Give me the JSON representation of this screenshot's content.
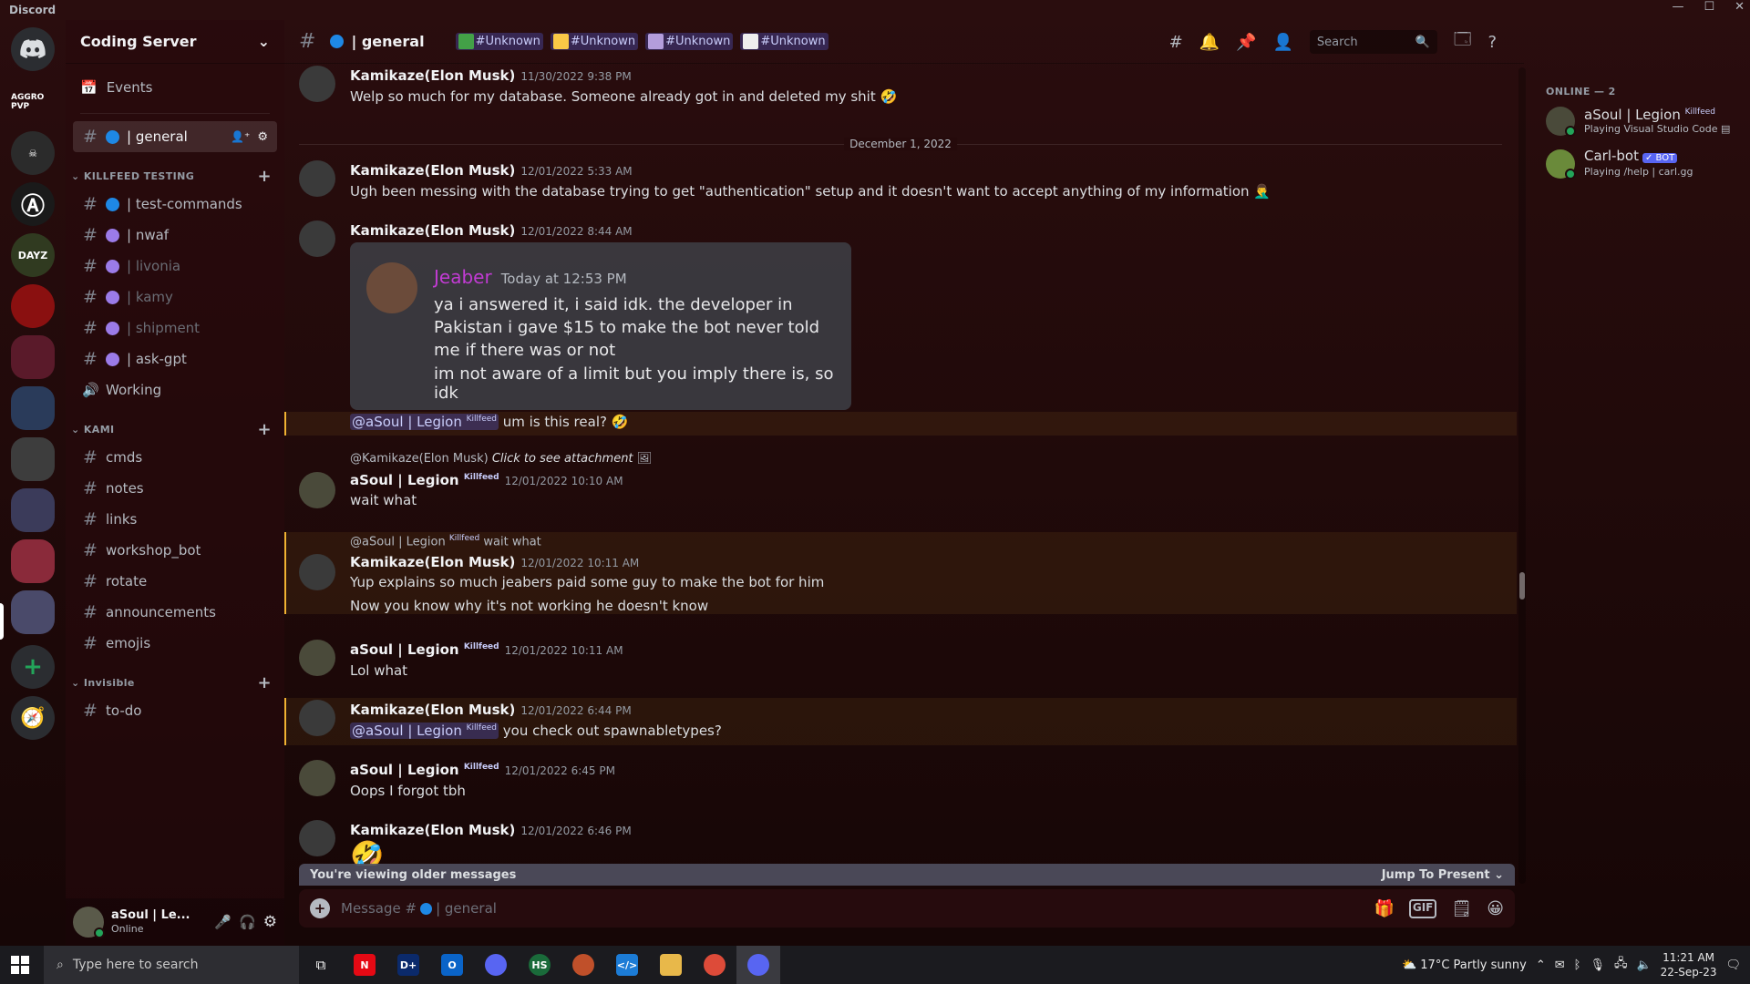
{
  "window": {
    "app_name": "Discord",
    "controls": [
      "—",
      "☐",
      "✕"
    ]
  },
  "rail": {
    "servers": [
      {
        "label": "AGGRO PVP",
        "color": "#3a1010"
      },
      {
        "label": "",
        "color": "#2b2b2b"
      },
      {
        "label": "Ⓐ",
        "color": "#1a1a1a"
      },
      {
        "label": "DAYZ",
        "color": "#303a20"
      },
      {
        "label": "",
        "color": "#8a1010"
      },
      {
        "label": "",
        "color": "#5a1a2a"
      },
      {
        "label": "",
        "color": "#2a3b5a"
      },
      {
        "label": "",
        "color": "#3d3d3d"
      },
      {
        "label": "",
        "color": "#3b3b5a"
      },
      {
        "label": "",
        "color": "#8a2a3a"
      },
      {
        "label": "",
        "color": "#4a4a6a"
      }
    ]
  },
  "server": {
    "name": "Coding Server"
  },
  "sidebar": {
    "events_label": "Events",
    "channels_top": [
      {
        "name": "| general",
        "dot": "#1e88e5",
        "active": true
      }
    ],
    "categories": [
      {
        "name": "KILLFEED TESTING",
        "channels": [
          {
            "name": "| test-commands",
            "dot": "#1e88e5",
            "muted": false,
            "type": "text"
          },
          {
            "name": "| nwaf",
            "dot": "#9b7be8",
            "muted": false,
            "type": "text"
          },
          {
            "name": "| livonia",
            "dot": "#9b7be8",
            "muted": true,
            "type": "text"
          },
          {
            "name": "| kamy",
            "dot": "#9b7be8",
            "muted": true,
            "type": "text"
          },
          {
            "name": "| shipment",
            "dot": "#9b7be8",
            "muted": true,
            "type": "text"
          },
          {
            "name": "| ask-gpt",
            "dot": "#9b7be8",
            "muted": false,
            "type": "text"
          },
          {
            "name": "Working",
            "dot": "",
            "muted": false,
            "type": "voice"
          }
        ]
      },
      {
        "name": "KAMI",
        "channels": [
          {
            "name": "cmds"
          },
          {
            "name": "notes"
          },
          {
            "name": "links"
          },
          {
            "name": "workshop_bot"
          },
          {
            "name": "rotate"
          },
          {
            "name": "announcements"
          },
          {
            "name": "emojis"
          }
        ]
      },
      {
        "name": "Invisible",
        "channels": [
          {
            "name": "to-do"
          }
        ]
      }
    ]
  },
  "user_panel": {
    "name": "aSoul | Le...",
    "status": "Online"
  },
  "chat": {
    "channel_title": "| general",
    "topic_tags": [
      {
        "color": "#43a047",
        "label": "#Unknown"
      },
      {
        "color": "#f9c846",
        "label": "#Unknown"
      },
      {
        "color": "#b39ddb",
        "label": "#Unknown"
      },
      {
        "color": "#eeeeee",
        "label": "#Unknown"
      }
    ],
    "search_placeholder": "Search"
  },
  "messages": {
    "m1": {
      "author": "Kamikaze(Elon Musk)",
      "time": "11/30/2022 9:38 PM",
      "text": "Welp so much for my database. Someone already got in and deleted my shit 🤣"
    },
    "divider": "December 1, 2022",
    "m2": {
      "author": "Kamikaze(Elon Musk)",
      "time": "12/01/2022 5:33 AM",
      "text": "Ugh been messing with the database trying to get \"authentication\" setup and it doesn't want to accept anything of my information 🤦‍♂️"
    },
    "m3": {
      "author": "Kamikaze(Elon Musk)",
      "time": "12/01/2022 8:44 AM"
    },
    "embed": {
      "author": "Jeaber",
      "time": "Today at 12:53 PM",
      "line1": "ya i answered it, i said idk. the developer in Pakistan i gave $15 to make the bot never told me if there was or not",
      "line2": "im not aware of a limit but you imply there is, so idk"
    },
    "m3b": {
      "mention": "@aSoul | Legion",
      "badge": "Killfeed",
      "text": "um is this real? 🤣"
    },
    "m4": {
      "reply_to": "@Kamikaze(Elon Musk)",
      "reply_text": "Click to see attachment",
      "author": "aSoul | Legion",
      "badge": "Killfeed",
      "time": "12/01/2022 10:10 AM",
      "text": "wait what"
    },
    "m5": {
      "reply_to": "@aSoul | Legion",
      "reply_badge": "Killfeed",
      "reply_text": "wait what",
      "author": "Kamikaze(Elon Musk)",
      "time": "12/01/2022 10:11 AM",
      "text": "Yup explains so much jeabers paid some guy to make the bot for him",
      "text2": "Now you know why it's not working he doesn't know"
    },
    "m6": {
      "author": "aSoul | Legion",
      "badge": "Killfeed",
      "time": "12/01/2022 10:11 AM",
      "text": "Lol what"
    },
    "m7": {
      "author": "Kamikaze(Elon Musk)",
      "time": "12/01/2022 6:44 PM",
      "mention": "@aSoul | Legion",
      "badge": "Killfeed",
      "text": "you check out spawnabletypes?"
    },
    "m8": {
      "author": "aSoul | Legion",
      "badge": "Killfeed",
      "time": "12/01/2022 6:45 PM",
      "text": "Oops I forgot tbh"
    },
    "m9": {
      "author": "Kamikaze(Elon Musk)",
      "time": "12/01/2022 6:46 PM",
      "text": "🤣"
    }
  },
  "older_bar": {
    "text": "You're viewing older messages",
    "jump": "Jump To Present"
  },
  "composer": {
    "placeholder_prefix": "Message #",
    "placeholder_suffix": "| general"
  },
  "members": {
    "header": "ONLINE — 2",
    "list": [
      {
        "name": "aSoul | Legion",
        "badge": "Killfeed",
        "activity": "Playing Visual Studio Code"
      },
      {
        "name": "Carl-bot",
        "bot": "✓ BOT",
        "activity": "Playing /help | carl.gg"
      }
    ]
  },
  "taskbar": {
    "search_placeholder": "Type here to search",
    "apps": [
      {
        "label": "N",
        "color": "#e50914"
      },
      {
        "label": "D+",
        "color": "#0b2a6b"
      },
      {
        "label": "O",
        "color": "#0a64c8"
      },
      {
        "label": "",
        "color": "#5865f2"
      },
      {
        "label": "HS",
        "color": "#1a6b3a"
      },
      {
        "label": "",
        "color": "#c0502a"
      },
      {
        "label": "</>",
        "color": "#1c7cd6"
      },
      {
        "label": "",
        "color": "#e8b84a"
      },
      {
        "label": "",
        "color": "#dd4b39"
      },
      {
        "label": "",
        "color": "#5865f2"
      }
    ],
    "weather": "17°C  Partly sunny",
    "time": "11:21 AM",
    "date": "22-Sep-23"
  }
}
